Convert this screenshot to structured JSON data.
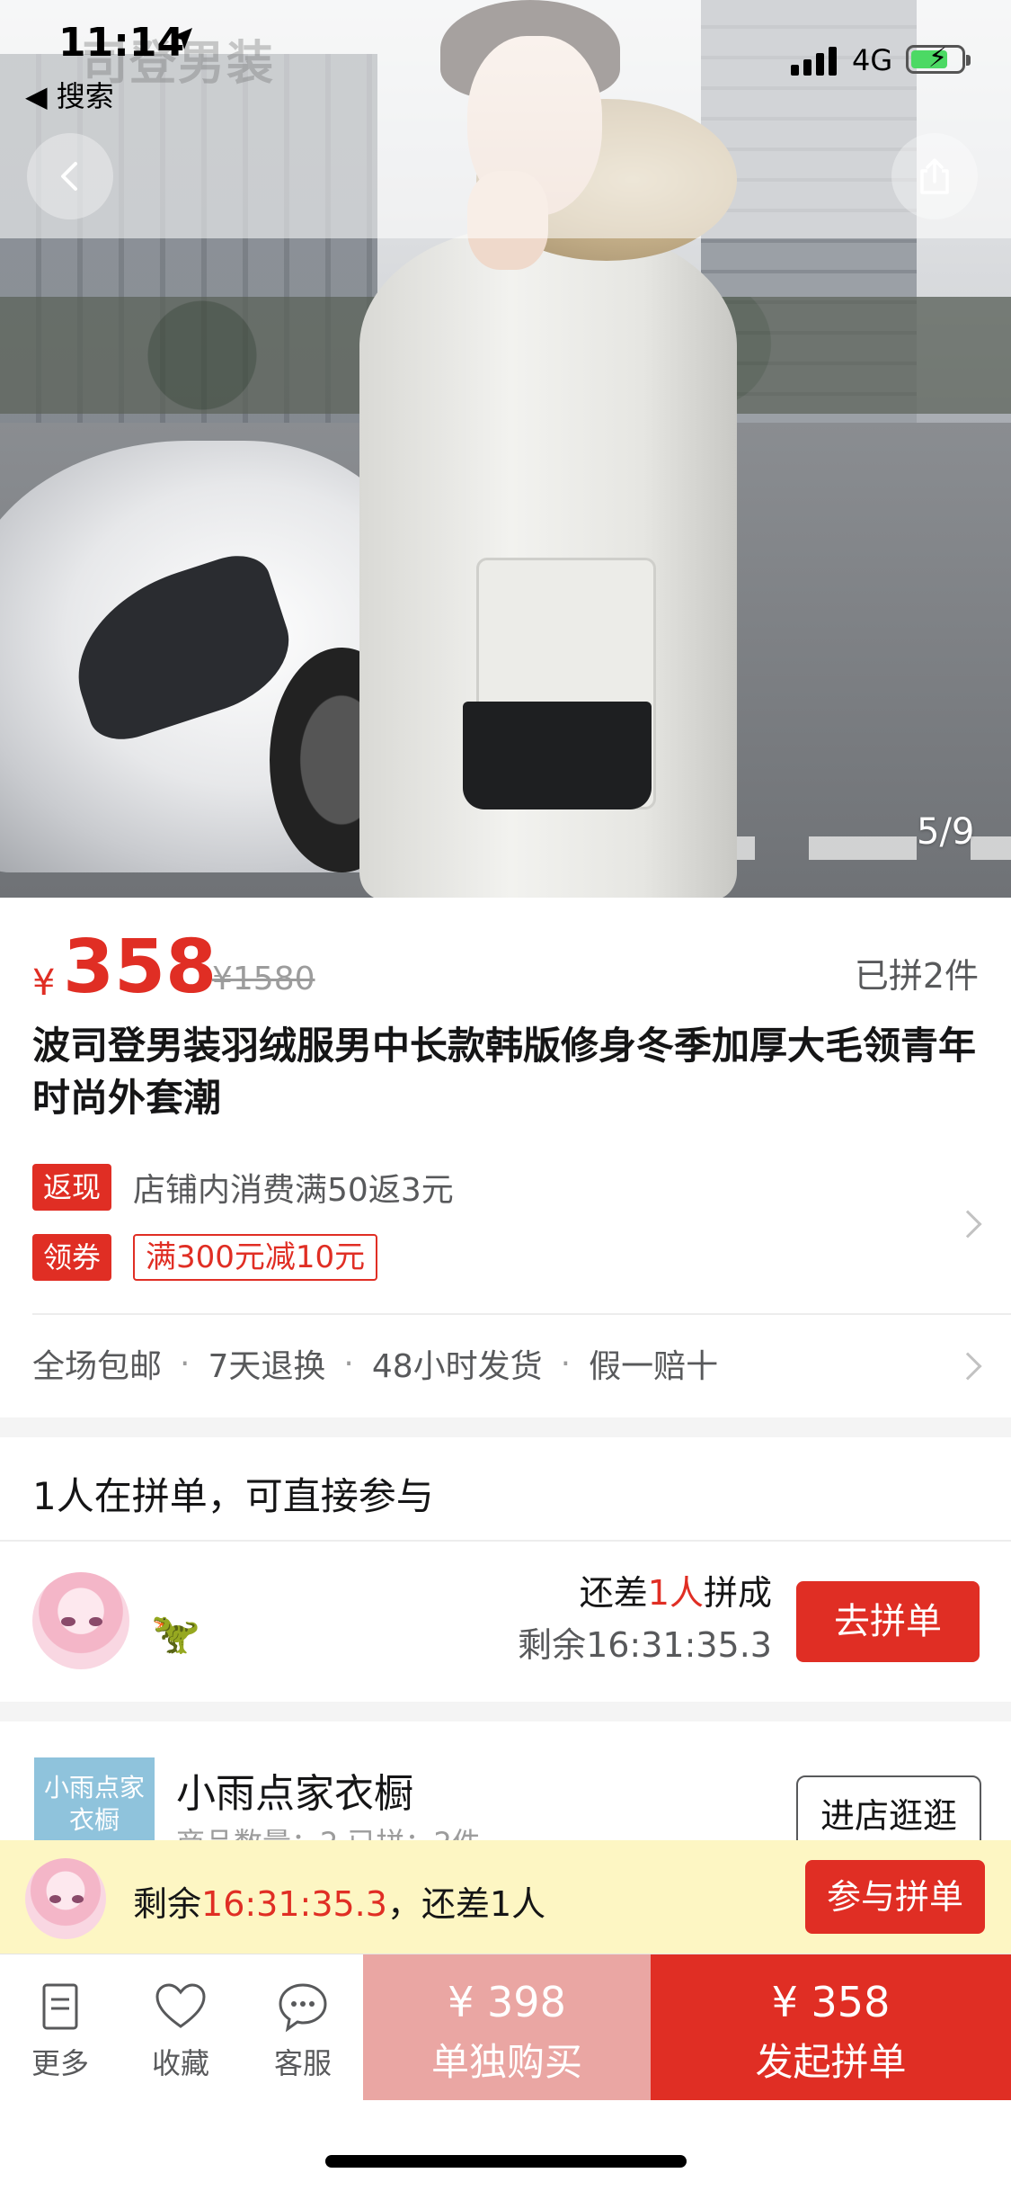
{
  "status_bar": {
    "time": "11:14",
    "back_app": "◀ 搜索",
    "network": "4G"
  },
  "hero": {
    "brand_watermark": "司登男装",
    "page_indicator": "5/9"
  },
  "price": {
    "currency": "¥",
    "value": "358",
    "original": "¥1580",
    "sold": "已拼2件"
  },
  "title": "波司登男装羽绒服男中长款韩版修身冬季加厚大毛领青年时尚外套潮",
  "promos": {
    "cashback_tag": "返现",
    "cashback_text": "店铺内消费满50返3元",
    "coupon_tag": "领券",
    "coupon_text": "满300元减10元"
  },
  "services": [
    "全场包邮",
    "7天退换",
    "48小时发货",
    "假一赔十"
  ],
  "group": {
    "heading": "1人在拼单，可直接参与",
    "user_emoji": "🦖",
    "need_prefix": "还差",
    "need_count": "1人",
    "need_suffix": "拼成",
    "remaining": "剩余16:31:35.3",
    "join_button": "去拼单"
  },
  "shop": {
    "logo_text": "小雨点家衣橱",
    "name": "小雨点家衣橱",
    "sub": "商品数量：2   已拼：2件",
    "visit_button": "进店逛逛"
  },
  "float_banner": {
    "prefix": "剩余",
    "time": "16:31:35.3",
    "suffix": "，还差1人",
    "button": "参与拼单"
  },
  "bottom_bar": {
    "more": "更多",
    "favorite": "收藏",
    "service": "客服",
    "alone_price": "¥ 398",
    "alone_label": "单独购买",
    "group_price": "¥ 358",
    "group_label": "发起拼单"
  },
  "colors": {
    "accent_red": "#e02e24",
    "alone_pink": "#eaa6a3",
    "banner_yellow": "#fdf6c3"
  }
}
